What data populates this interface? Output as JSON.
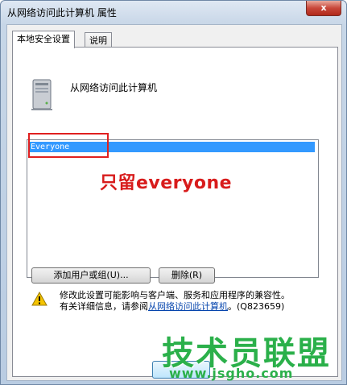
{
  "window": {
    "title": "从网络访问此计算机 属性",
    "close_label": "x"
  },
  "tabs": [
    {
      "label": "本地安全设置"
    },
    {
      "label": "说明"
    }
  ],
  "policy": {
    "name": "从网络访问此计算机",
    "icon": "computer-icon"
  },
  "user_list": {
    "items": [
      "Everyone"
    ],
    "selected": "Everyone"
  },
  "annotation": {
    "text": "只留everyone",
    "color": "#d81c1c"
  },
  "buttons": {
    "add": "添加用户或组(U)...",
    "remove": "删除(R)",
    "ok": "确定"
  },
  "warning": {
    "line1": "修改此设置可能影响与客户端、服务和应用程序的兼容性。",
    "line2_prefix": "有关详细信息，请参阅",
    "link_text": "从网络访问此计算机",
    "kb": "。(Q823659)"
  },
  "watermark": {
    "text": "技术员联盟",
    "url": "www.jsgho.com",
    "color": "#2bb04a"
  }
}
